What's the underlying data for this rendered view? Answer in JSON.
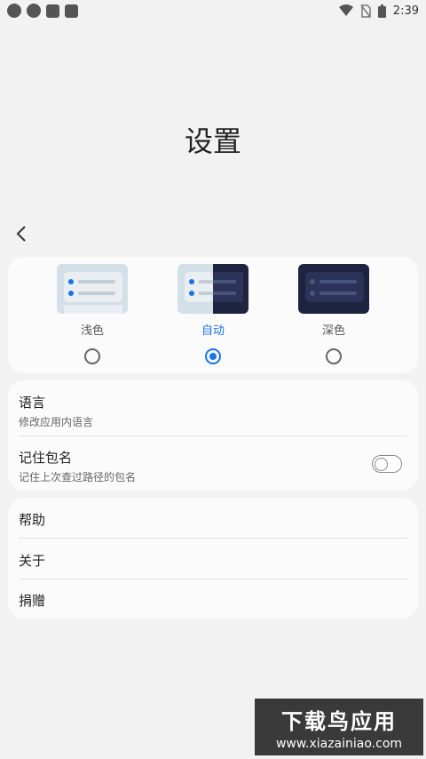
{
  "status_bar": {
    "time": "2:39"
  },
  "page": {
    "title": "设置"
  },
  "theme": {
    "options": [
      {
        "label": "浅色",
        "selected": false
      },
      {
        "label": "自动",
        "selected": true
      },
      {
        "label": "深色",
        "selected": false
      }
    ]
  },
  "settings": {
    "language": {
      "title": "语言",
      "subtitle": "修改应用内语言"
    },
    "remember_package": {
      "title": "记住包名",
      "subtitle": "记住上次查过路径的包名",
      "enabled": false
    }
  },
  "links": {
    "help": "帮助",
    "about": "关于",
    "donate": "捐赠"
  },
  "watermark": {
    "title": "下载鸟应用",
    "url": "www.xiazainiao.com"
  },
  "colors": {
    "accent": "#1a73e8",
    "card_bg": "#fbfbfb",
    "page_bg": "#f2f2f2"
  }
}
